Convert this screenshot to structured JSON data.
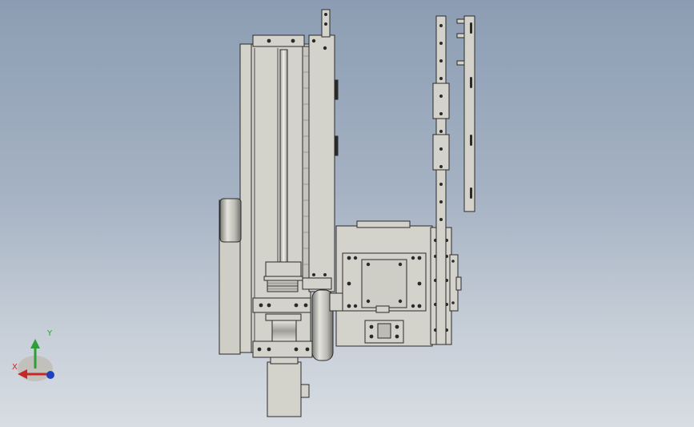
{
  "viewport": {
    "background_top": "#8c9db3",
    "background_bottom": "#d8dde3"
  },
  "model": {
    "part_fill": "#d4d3cb",
    "part_stroke": "#2a2a2a",
    "shadow_fill": "#9a9a94"
  },
  "triad": {
    "x_label": "X",
    "y_label": "Y",
    "x_color": "#c62828",
    "y_color": "#2e9d3a",
    "z_color": "#1f3fbf"
  }
}
